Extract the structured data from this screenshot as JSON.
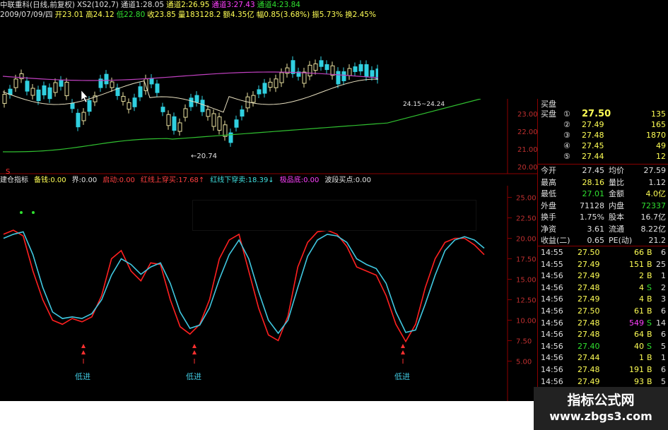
{
  "header": {
    "row1": [
      {
        "text": "中联重科(日线,前复权)",
        "color": "#e0e0e0"
      },
      {
        "text": "XS2(102,7)",
        "color": "#e0e0e0"
      },
      {
        "text": "通道1:28.05",
        "color": "#e0e0e0"
      },
      {
        "text": "通道2:26.95",
        "color": "#ffff55"
      },
      {
        "text": "通道3:27.43",
        "color": "#ff40ff"
      },
      {
        "text": "通道4:23.84",
        "color": "#30e030"
      }
    ],
    "row2": [
      {
        "text": "2009/07/09/四",
        "color": "#e0e0e0"
      },
      {
        "text": "开23.01",
        "color": "#ffff55"
      },
      {
        "text": "高24.12",
        "color": "#ffff55"
      },
      {
        "text": "低22.80",
        "color": "#30e030"
      },
      {
        "text": "收23.85",
        "color": "#ffff55"
      },
      {
        "text": "量183128.2",
        "color": "#ffff55"
      },
      {
        "text": "额4.35亿",
        "color": "#ffff55"
      },
      {
        "text": "幅0.85(3.68%)",
        "color": "#ffff55"
      },
      {
        "text": "振5.73%",
        "color": "#ffff55"
      },
      {
        "text": "换2.45%",
        "color": "#ffff55"
      }
    ]
  },
  "price_chart": {
    "y_ticks": [
      "23.00",
      "22.00",
      "21.00",
      "20.00"
    ],
    "low_annotation": "←20.74",
    "range_annotation": "24.15~24.24",
    "s_marker": "S"
  },
  "indicator": {
    "header": [
      {
        "text": "建仓指标",
        "color": "#e0e0e0"
      },
      {
        "text": "备钱:0.00",
        "color": "#ffff55"
      },
      {
        "text": "界:0.00",
        "color": "#e0e0e0"
      },
      {
        "text": "启动:0.00",
        "color": "#ff4040"
      },
      {
        "text": "红线上穿买:17.68↑",
        "color": "#ff4040"
      },
      {
        "text": "红线下穿卖:18.39↓",
        "color": "#40e0e0"
      },
      {
        "text": "极品底:0.00",
        "color": "#ff40ff"
      },
      {
        "text": "波段买点:0.00",
        "color": "#e0e0e0"
      }
    ],
    "y_ticks": [
      "25.00",
      "22.50",
      "20.00",
      "17.50",
      "15.00",
      "12.50",
      "10.00",
      "7.50",
      "5.00"
    ],
    "buy_labels": [
      "低进",
      "低进",
      "低进"
    ],
    "chart_data": {
      "type": "line",
      "ylim": [
        4,
        26
      ],
      "series": [
        {
          "name": "红线",
          "color": "#ff2020",
          "values": [
            20.5,
            21,
            20.3,
            16,
            12.5,
            10,
            9.5,
            10.2,
            9.8,
            10.4,
            13,
            17.5,
            18.5,
            16,
            14.8,
            17,
            16.8,
            12.5,
            9.2,
            8.3,
            9.5,
            12.5,
            17.5,
            19.8,
            20.5,
            16,
            11.5,
            8.2,
            7.5,
            10.5,
            16.5,
            19.5,
            20.8,
            21,
            20.5,
            19,
            16.5,
            16,
            15.5,
            13,
            9.5,
            7.4,
            9.5,
            14,
            17.5,
            19.5,
            20,
            20,
            19.2,
            18
          ]
        },
        {
          "name": "蓝线",
          "color": "#40c8e0",
          "values": [
            20,
            20.5,
            20.8,
            18,
            14,
            11,
            10.2,
            10.4,
            10.2,
            10.8,
            12.5,
            15.5,
            17.5,
            16.8,
            15.6,
            16.5,
            17,
            14.5,
            11,
            9,
            9.4,
            11.5,
            15,
            18,
            19.8,
            17.5,
            13.5,
            10,
            8.4,
            10,
            14,
            17.8,
            19.8,
            20.5,
            20.3,
            19.5,
            17.5,
            16.8,
            16.3,
            14.5,
            11,
            8.5,
            8.8,
            12,
            15.5,
            18.5,
            19.8,
            20.2,
            19.8,
            18.8
          ]
        }
      ]
    }
  },
  "quote_panel": {
    "bid_header": "买盘",
    "bids": [
      {
        "idx": "①",
        "price": "27.50",
        "vol": "135"
      },
      {
        "idx": "②",
        "price": "27.49",
        "vol": "165"
      },
      {
        "idx": "③",
        "price": "27.48",
        "vol": "1870"
      },
      {
        "idx": "④",
        "price": "27.45",
        "vol": "49"
      },
      {
        "idx": "⑤",
        "price": "27.44",
        "vol": "12"
      }
    ],
    "stats": [
      {
        "l1": "今开",
        "v1": "27.45",
        "l2": "均价",
        "v2": "27.59",
        "c1": "#e0e0e0",
        "c2": "#e0e0e0"
      },
      {
        "l1": "最高",
        "v1": "28.16",
        "l2": "量比",
        "v2": "1.12",
        "c1": "#ffff55",
        "c2": "#e0e0e0"
      },
      {
        "l1": "最低",
        "v1": "27.01",
        "l2": "金额",
        "v2": "4.0亿",
        "c1": "#30e030",
        "c2": "#ffff55"
      },
      {
        "l1": "外盘",
        "v1": "71128",
        "l2": "内盘",
        "v2": "72337",
        "c1": "#e0e0e0",
        "c2": "#30e030"
      },
      {
        "l1": "换手",
        "v1": "1.75%",
        "l2": "股本",
        "v2": "16.7亿",
        "c1": "#e0e0e0",
        "c2": "#e0e0e0"
      },
      {
        "l1": "净资",
        "v1": "3.61",
        "l2": "流通",
        "v2": "8.22亿",
        "c1": "#e0e0e0",
        "c2": "#e0e0e0"
      },
      {
        "l1": "收益(二)",
        "v1": "0.65",
        "l2": "PE(动)",
        "v2": "21.2",
        "c1": "#e0e0e0",
        "c2": "#e0e0e0"
      }
    ],
    "trades": [
      {
        "time": "14:55",
        "price": "27.50",
        "vol": "66",
        "side": "B",
        "n": "6",
        "pc": "#ffff55",
        "vc": "#ffff55",
        "sc": "#ffff55"
      },
      {
        "time": "14:55",
        "price": "27.49",
        "vol": "151",
        "side": "B",
        "n": "25",
        "pc": "#ffff55",
        "vc": "#ffff55",
        "sc": "#ffff55"
      },
      {
        "time": "14:56",
        "price": "27.49",
        "vol": "2",
        "side": "B",
        "n": "1",
        "pc": "#ffff55",
        "vc": "#ffff55",
        "sc": "#ffff55"
      },
      {
        "time": "14:56",
        "price": "27.48",
        "vol": "4",
        "side": "S",
        "n": "2",
        "pc": "#ffff55",
        "vc": "#ffff55",
        "sc": "#30e030"
      },
      {
        "time": "14:56",
        "price": "27.49",
        "vol": "4",
        "side": "B",
        "n": "3",
        "pc": "#ffff55",
        "vc": "#ffff55",
        "sc": "#ffff55"
      },
      {
        "time": "14:56",
        "price": "27.50",
        "vol": "61",
        "side": "B",
        "n": "6",
        "pc": "#ffff55",
        "vc": "#ffff55",
        "sc": "#ffff55"
      },
      {
        "time": "14:56",
        "price": "27.48",
        "vol": "549",
        "side": "S",
        "n": "14",
        "pc": "#ffff55",
        "vc": "#ff40ff",
        "sc": "#30e030"
      },
      {
        "time": "14:56",
        "price": "27.48",
        "vol": "64",
        "side": "B",
        "n": "6",
        "pc": "#ffff55",
        "vc": "#ffff55",
        "sc": "#ffff55"
      },
      {
        "time": "14:56",
        "price": "27.40",
        "vol": "40",
        "side": "S",
        "n": "5",
        "pc": "#30e030",
        "vc": "#ffff55",
        "sc": "#30e030"
      },
      {
        "time": "14:56",
        "price": "27.44",
        "vol": "1",
        "side": "B",
        "n": "1",
        "pc": "#ffff55",
        "vc": "#ffff55",
        "sc": "#ffff55"
      },
      {
        "time": "14:56",
        "price": "27.48",
        "vol": "191",
        "side": "B",
        "n": "6",
        "pc": "#ffff55",
        "vc": "#ffff55",
        "sc": "#ffff55"
      },
      {
        "time": "14:56",
        "price": "27.49",
        "vol": "93",
        "side": "B",
        "n": "5",
        "pc": "#ffff55",
        "vc": "#ffff55",
        "sc": "#ffff55"
      }
    ]
  },
  "watermark": {
    "line1": "指标公式网",
    "line2": "www.zbgs3.com"
  }
}
